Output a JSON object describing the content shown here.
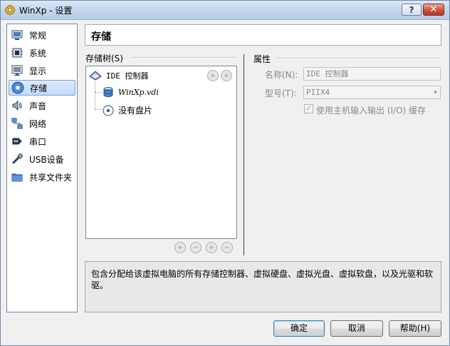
{
  "window": {
    "title": "WinXp - 设置",
    "help_label": "?",
    "close_label": "✕"
  },
  "sidebar": {
    "items": [
      {
        "label": "常规",
        "icon": "general-icon",
        "selected": false
      },
      {
        "label": "系统",
        "icon": "system-icon",
        "selected": false
      },
      {
        "label": "显示",
        "icon": "display-icon",
        "selected": false
      },
      {
        "label": "存储",
        "icon": "storage-icon",
        "selected": true
      },
      {
        "label": "声音",
        "icon": "audio-icon",
        "selected": false
      },
      {
        "label": "网络",
        "icon": "network-icon",
        "selected": false
      },
      {
        "label": "串口",
        "icon": "serial-port-icon",
        "selected": false
      },
      {
        "label": "USB设备",
        "icon": "usb-icon",
        "selected": false
      },
      {
        "label": "共享文件夹",
        "icon": "shared-folder-icon",
        "selected": false
      }
    ]
  },
  "page": {
    "title": "存储"
  },
  "storage_tree": {
    "label": "存储树(S)",
    "controller": "IDE 控制器",
    "disk": "WinXp.vdi",
    "cd": "没有盘片"
  },
  "properties": {
    "label": "属性",
    "name_label": "名称(N):",
    "name_value": "IDE 控制器",
    "type_label": "型号(T):",
    "type_value": "PIIX4",
    "host_io_label": "使用主机输入输出 (I/O) 缓存",
    "host_io_checked": true
  },
  "description": "包含分配给该虚拟电脑的所有存储控制器、虚拟硬盘、虚拟光盘、虚拟软盘，以及光驱和软驱。",
  "buttons": {
    "ok": "确定",
    "cancel": "取消",
    "help": "帮助(H)"
  }
}
